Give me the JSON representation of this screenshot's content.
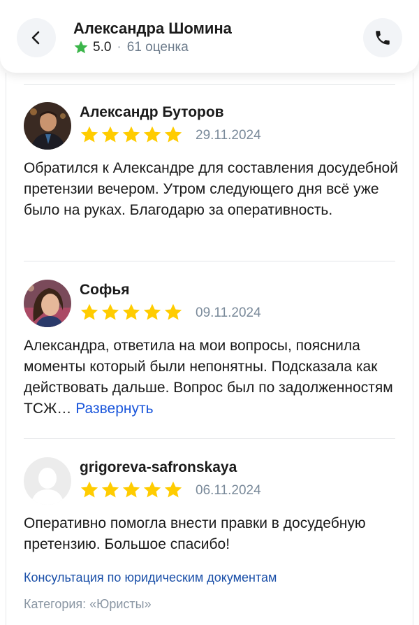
{
  "header": {
    "title": "Александра Шомина",
    "rating_value": "5.0",
    "rating_separator": "·",
    "rating_count": "61 оценка"
  },
  "colors": {
    "star": "#FFCC00",
    "header_star": "#3BB54A",
    "link": "#1A56DB"
  },
  "reviews": [
    {
      "author": "Александр Буторов",
      "stars": 5,
      "date": "29.11.2024",
      "text": "Обратился к Александре для составления досудебной претензии вечером. Утром следующего дня всё уже было на руках. Благодарю за оперативность."
    },
    {
      "author": "Софья",
      "stars": 5,
      "date": "09.11.2024",
      "text": "Александра, ответила на мои вопросы, пояснила моменты который были непонятны. Подсказала как действовать дальше. Вопрос был по задолженностям ТСЖ…",
      "expand_label": "Развернуть"
    },
    {
      "author": "grigoreva-safronskaya",
      "stars": 5,
      "date": "06.11.2024",
      "text": "Оперативно помогла внести правки в досудебную претензию. Большое спасибо!",
      "service": "Консультация по юридическим документам",
      "category": "Категория: «Юристы»"
    }
  ]
}
